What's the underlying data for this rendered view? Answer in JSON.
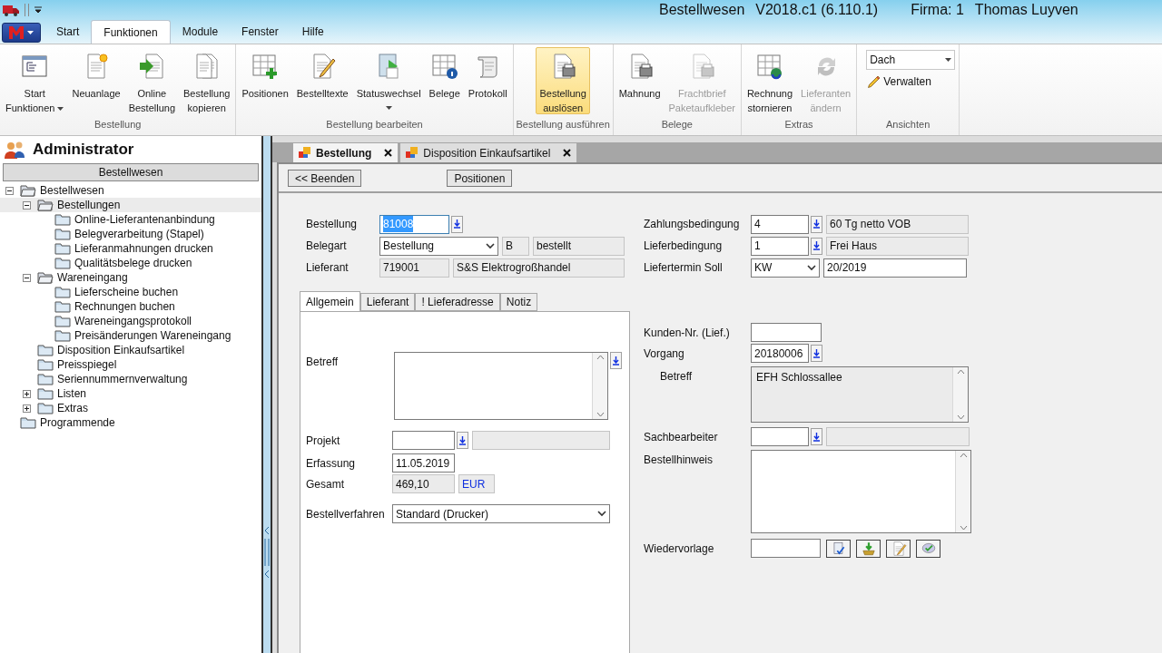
{
  "title_bar": {
    "app": "Bestellwesen",
    "version": "V2018.c1 (6.110.1)",
    "company": "Firma: 1",
    "user": "Thomas Luyven"
  },
  "menu_tabs": [
    {
      "label": "Start",
      "selected": false
    },
    {
      "label": "Funktionen",
      "selected": true
    },
    {
      "label": "Module",
      "selected": false
    },
    {
      "label": "Fenster",
      "selected": false
    },
    {
      "label": "Hilfe",
      "selected": false
    }
  ],
  "ribbon_groups": [
    {
      "title": "Bestellung",
      "items": [
        {
          "kind": "button",
          "lines": [
            "Start",
            "Funktionen"
          ],
          "dropdown": true,
          "disabled": false,
          "highlighted": false
        },
        {
          "kind": "button",
          "lines": [
            "Neuanlage"
          ],
          "dropdown": false,
          "disabled": false,
          "highlighted": false
        },
        {
          "kind": "button",
          "lines": [
            "Online",
            "Bestellung"
          ],
          "dropdown": false,
          "disabled": false,
          "highlighted": false
        },
        {
          "kind": "button",
          "lines": [
            "Bestellung",
            "kopieren"
          ],
          "dropdown": false,
          "disabled": false,
          "highlighted": false
        }
      ]
    },
    {
      "title": "Bestellung bearbeiten",
      "items": [
        {
          "kind": "button",
          "lines": [
            "Positionen"
          ],
          "dropdown": false,
          "disabled": false,
          "highlighted": false
        },
        {
          "kind": "button",
          "lines": [
            "Bestelltexte"
          ],
          "dropdown": false,
          "disabled": false,
          "highlighted": false
        },
        {
          "kind": "button",
          "lines": [
            "Statuswechsel"
          ],
          "dropdown": true,
          "disabled": false,
          "highlighted": false
        },
        {
          "kind": "button",
          "lines": [
            "Belege"
          ],
          "dropdown": false,
          "disabled": false,
          "highlighted": false
        },
        {
          "kind": "button",
          "lines": [
            "Protokoll"
          ],
          "dropdown": false,
          "disabled": false,
          "highlighted": false
        }
      ]
    },
    {
      "title": "Bestellung ausführen",
      "items": [
        {
          "kind": "button",
          "lines": [
            "Bestellung",
            "auslösen"
          ],
          "dropdown": false,
          "disabled": false,
          "highlighted": true
        }
      ]
    },
    {
      "title": "Belege",
      "items": [
        {
          "kind": "button",
          "lines": [
            "Mahnung"
          ],
          "dropdown": false,
          "disabled": false,
          "highlighted": false
        },
        {
          "kind": "button",
          "lines": [
            "Frachtbrief",
            "Paketaufkleber"
          ],
          "dropdown": false,
          "disabled": true,
          "highlighted": false
        }
      ]
    },
    {
      "title": "Extras",
      "items": [
        {
          "kind": "button",
          "lines": [
            "Rechnung",
            "stornieren"
          ],
          "dropdown": false,
          "disabled": false,
          "highlighted": false
        },
        {
          "kind": "button",
          "lines": [
            "Lieferanten",
            "ändern"
          ],
          "dropdown": false,
          "disabled": true,
          "highlighted": false
        }
      ]
    },
    {
      "title": "Ansichten",
      "items": [
        {
          "kind": "combo",
          "value": "Dach"
        },
        {
          "kind": "link",
          "lines": [
            "Verwalten"
          ]
        }
      ]
    }
  ],
  "sidebar": {
    "user": "Administrator",
    "section": "Bestellwesen",
    "tree": [
      {
        "label": "Bestellwesen",
        "expanded": true,
        "selected": false,
        "children": [
          {
            "label": "Bestellungen",
            "expanded": true,
            "selected": true,
            "children": [
              {
                "label": "Online-Lieferantenanbindung",
                "selected": false
              },
              {
                "label": "Belegverarbeitung (Stapel)",
                "selected": false
              },
              {
                "label": "Lieferanmahnungen drucken",
                "selected": false
              },
              {
                "label": "Qualitätsbelege drucken",
                "selected": false
              }
            ]
          },
          {
            "label": "Wareneingang",
            "expanded": true,
            "selected": false,
            "children": [
              {
                "label": "Lieferscheine buchen",
                "selected": false
              },
              {
                "label": "Rechnungen buchen",
                "selected": false
              },
              {
                "label": "Wareneingangsprotokoll",
                "selected": false
              },
              {
                "label": "Preisänderungen Wareneingang",
                "selected": false
              }
            ]
          },
          {
            "label": "Disposition Einkaufsartikel",
            "selected": false
          },
          {
            "label": "Preisspiegel",
            "selected": false
          },
          {
            "label": "Seriennummernverwaltung",
            "selected": false
          },
          {
            "label": "Listen",
            "expanded": false,
            "selected": false
          },
          {
            "label": "Extras",
            "expanded": false,
            "selected": false
          }
        ]
      },
      {
        "label": "Programmende",
        "selected": false
      }
    ]
  },
  "doc_tabs": [
    {
      "label": "Bestellung",
      "selected": true
    },
    {
      "label": "Disposition Einkaufsartikel",
      "selected": false
    }
  ],
  "toolbar": [
    "<< Beenden",
    "Positionen"
  ],
  "form": {
    "header_left": [
      {
        "label": "Bestellung",
        "controls": [
          {
            "kind": "input",
            "value": "81008",
            "text_selected": true
          },
          {
            "kind": "lookup"
          }
        ]
      },
      {
        "label": "Belegart",
        "controls": [
          {
            "kind": "select",
            "value": "Bestellung"
          },
          {
            "kind": "readonly",
            "value": "B"
          },
          {
            "kind": "readonly",
            "value": "bestellt"
          }
        ]
      },
      {
        "label": "Lieferant",
        "controls": [
          {
            "kind": "readonly",
            "value": "719001"
          },
          {
            "kind": "readonly",
            "value": "S&S Elektrogroßhandel"
          }
        ]
      }
    ],
    "header_right": [
      {
        "label": "Zahlungsbedingung",
        "controls": [
          {
            "kind": "input",
            "value": "4"
          },
          {
            "kind": "lookup"
          },
          {
            "kind": "readonly",
            "value": "60 Tg netto VOB"
          }
        ]
      },
      {
        "label": "Lieferbedingung",
        "controls": [
          {
            "kind": "input",
            "value": "1"
          },
          {
            "kind": "lookup"
          },
          {
            "kind": "readonly",
            "value": "Frei Haus"
          }
        ]
      },
      {
        "label": "Liefertermin Soll",
        "controls": [
          {
            "kind": "select",
            "value": "KW"
          },
          {
            "kind": "input",
            "value": "20/2019"
          }
        ]
      }
    ],
    "inner_tabs": [
      {
        "label": "Allgemein",
        "selected": true
      },
      {
        "label": "Lieferant",
        "selected": false
      },
      {
        "label": "! Lieferadresse",
        "selected": false
      },
      {
        "label": "Notiz",
        "selected": false
      }
    ],
    "tab_fields": [
      {
        "label": "Betreff",
        "controls": [
          {
            "kind": "textarea"
          },
          {
            "kind": "lookup"
          }
        ]
      },
      {
        "label": "Projekt",
        "controls": [
          {
            "kind": "input"
          },
          {
            "kind": "lookup"
          },
          {
            "kind": "readonly"
          }
        ]
      },
      {
        "label": "Erfassung",
        "controls": [
          {
            "kind": "input",
            "value": "11.05.2019"
          }
        ]
      },
      {
        "label": "Gesamt",
        "controls": [
          {
            "kind": "readonly",
            "value": "469,10"
          },
          {
            "kind": "currency",
            "value": "EUR"
          }
        ]
      },
      {
        "label": "Bestellverfahren",
        "controls": [
          {
            "kind": "select",
            "value": "Standard (Drucker)"
          }
        ]
      }
    ],
    "side_fields": [
      {
        "label": "Kunden-Nr. (Lief.)",
        "controls": [
          {
            "kind": "input"
          }
        ]
      },
      {
        "label": "Vorgang",
        "controls": [
          {
            "kind": "input",
            "value": "20180006"
          },
          {
            "kind": "lookup"
          }
        ]
      },
      {
        "label": "Betreff",
        "controls": [
          {
            "kind": "textarea_readonly",
            "value": "EFH Schlossallee"
          }
        ]
      },
      {
        "label": "Sachbearbeiter",
        "controls": [
          {
            "kind": "input"
          },
          {
            "kind": "lookup"
          },
          {
            "kind": "readonly"
          }
        ]
      },
      {
        "label": "Bestellhinweis",
        "controls": [
          {
            "kind": "textarea"
          }
        ]
      },
      {
        "label": "Wiedervorlage",
        "controls": [
          {
            "kind": "input"
          },
          {
            "kind": "icon_button"
          },
          {
            "kind": "icon_button"
          },
          {
            "kind": "icon_button"
          },
          {
            "kind": "icon_button"
          }
        ]
      }
    ]
  }
}
